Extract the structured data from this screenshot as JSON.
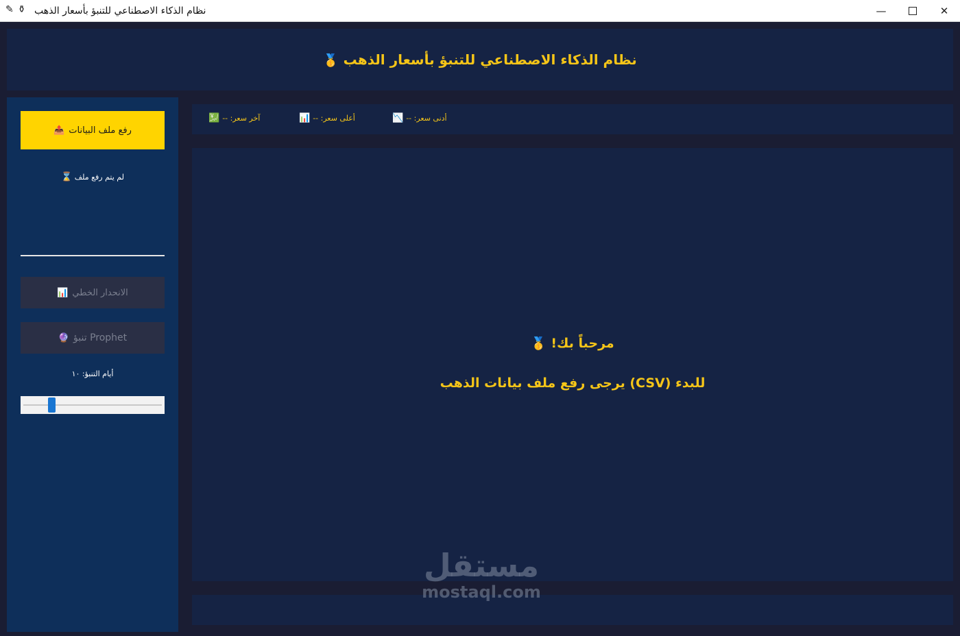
{
  "window": {
    "title": "نظام الذكاء الاصطناعي للتنبؤ بأسعار الذهب",
    "app_icon_1": "✎",
    "app_icon_2": "⚱",
    "minimize": "—",
    "close": "✕"
  },
  "header": {
    "title": "نظام الذكاء الاصطناعي للتنبؤ بأسعار الذهب",
    "icon": "🥇"
  },
  "sidebar": {
    "upload_label": "رفع ملف البيانات",
    "upload_icon": "📤",
    "file_status": "لم يتم رفع ملف",
    "file_status_icon": "⌛",
    "linear_label": "الانحدار الخطي",
    "linear_icon": "📊",
    "prophet_label": "Prophet تنبؤ",
    "prophet_icon": "🔮",
    "days_label": "أيام التنبؤ: ١٠",
    "slider_value": 10,
    "slider_max": 100
  },
  "stats": {
    "last": {
      "label": "آخر سعر: --",
      "icon": "💹"
    },
    "high": {
      "label": "أعلى سعر: --",
      "icon": "📊"
    },
    "low": {
      "label": "أدنى سعر: --",
      "icon": "📉"
    }
  },
  "main": {
    "welcome_title": "مرحباً بك!",
    "welcome_icon": "🥇",
    "welcome_sub": "للبدء (CSV) يرجى رفع ملف بيانات الذهب"
  },
  "watermark": {
    "arabic": "مستقل",
    "english": "mostaql.com"
  },
  "colors": {
    "gold": "#f5c518",
    "upload_button": "#ffd400",
    "panel": "#152344",
    "sidebar": "#0e2f5a",
    "background": "#1a1d33",
    "slider_thumb": "#1976d2"
  }
}
